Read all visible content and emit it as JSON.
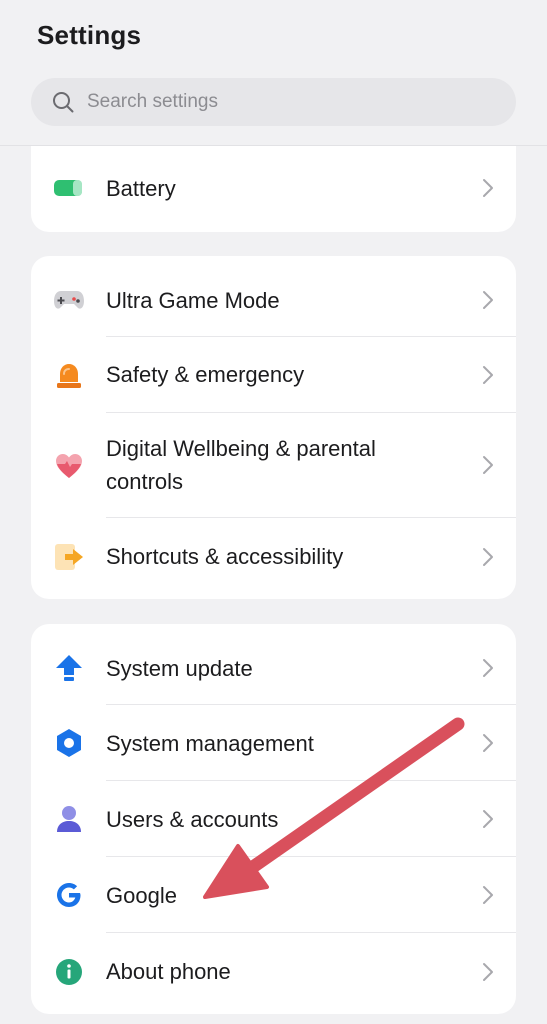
{
  "header": {
    "title": "Settings",
    "search_placeholder": "Search settings"
  },
  "cards": [
    {
      "rows": [
        {
          "label": "Battery",
          "icon": "battery-icon"
        }
      ]
    },
    {
      "rows": [
        {
          "label": "Ultra Game Mode",
          "icon": "gamepad-icon"
        },
        {
          "label": "Safety & emergency",
          "icon": "siren-icon"
        },
        {
          "label": "Digital Wellbeing & parental controls",
          "icon": "heart-icon"
        },
        {
          "label": "Shortcuts & accessibility",
          "icon": "shortcut-icon"
        }
      ]
    },
    {
      "rows": [
        {
          "label": "System update",
          "icon": "update-arrow-icon"
        },
        {
          "label": "System management",
          "icon": "hexagon-icon"
        },
        {
          "label": "Users & accounts",
          "icon": "user-icon"
        },
        {
          "label": "Google",
          "icon": "google-icon"
        },
        {
          "label": "About phone",
          "icon": "info-icon"
        }
      ]
    }
  ],
  "colors": {
    "battery": "#2fbf71",
    "siren": "#f58a1f",
    "heart": "#e85a6e",
    "shortcut": "#f5a623",
    "update": "#1a73e8",
    "hexagon": "#1a73e8",
    "user": "#5b5bd6",
    "info": "#26a67a",
    "annotation_arrow": "#d9505c"
  }
}
